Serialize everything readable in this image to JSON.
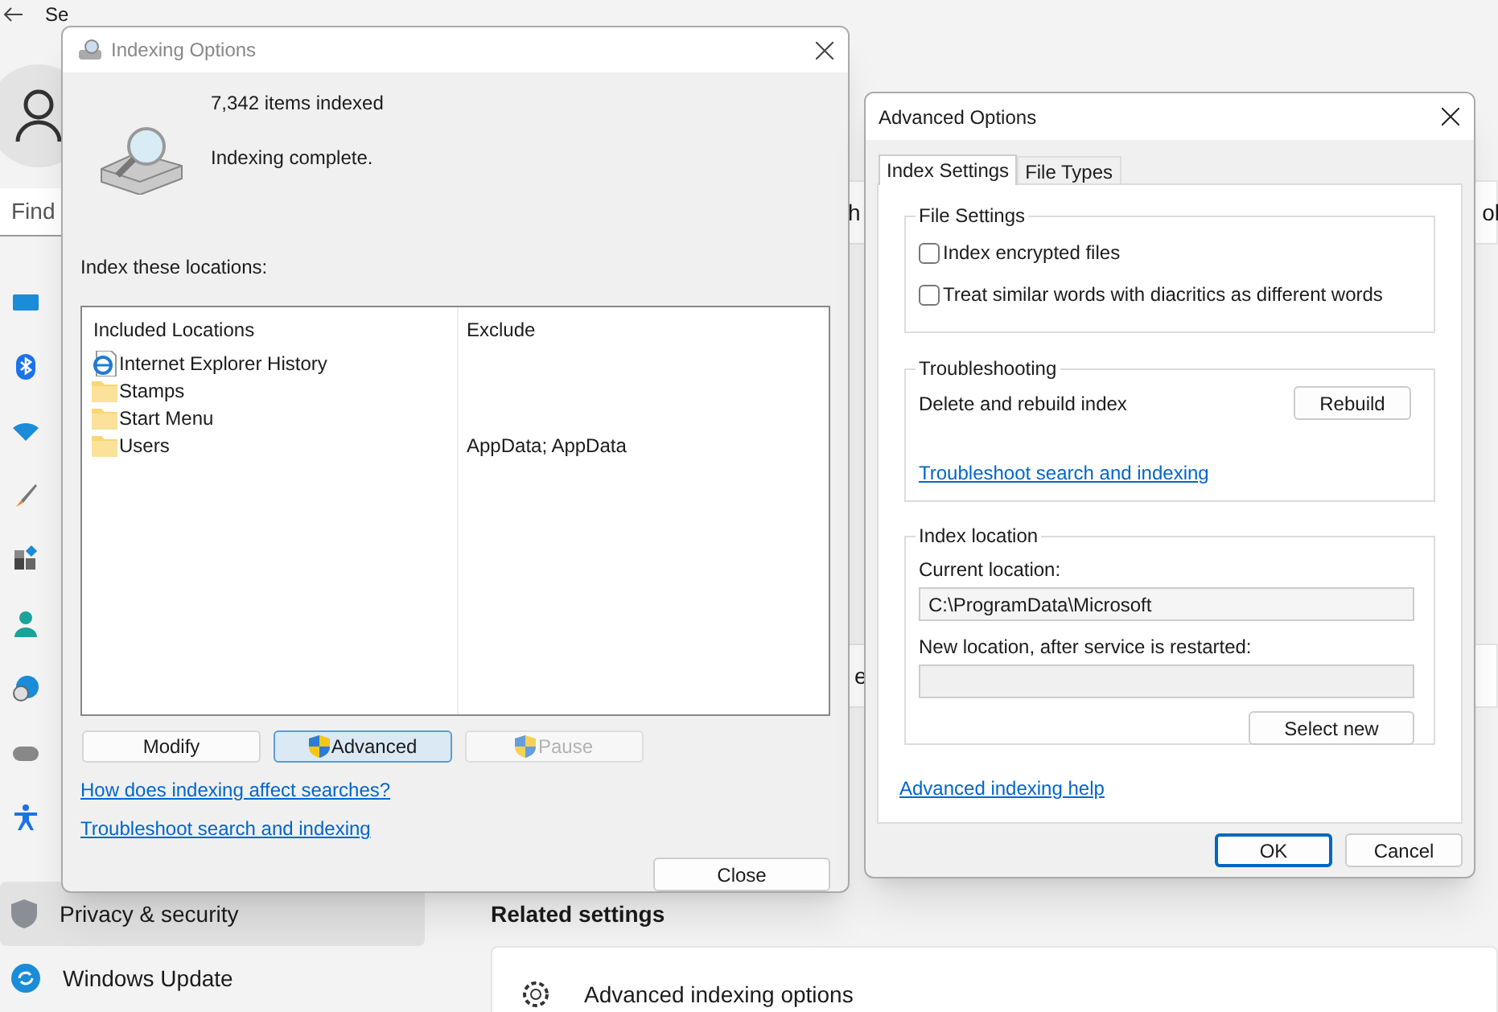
{
  "settings": {
    "title": "Se",
    "search": {
      "placeholder": "Find"
    },
    "nav": [
      {
        "label": "Privacy & security",
        "selected": true
      },
      {
        "label": "Windows Update",
        "selected": false
      }
    ],
    "fragments": [
      "h",
      "ol",
      "e"
    ],
    "related_settings": {
      "heading": "Related settings",
      "items": [
        "Advanced indexing options"
      ]
    }
  },
  "indexing_options": {
    "title": "Indexing Options",
    "count": "7,342 items indexed",
    "status": "Indexing complete.",
    "locations_label": "Index these locations:",
    "columns": [
      "Included Locations",
      "Exclude"
    ],
    "rows": [
      {
        "kind": "web",
        "location": "Internet Explorer History"
      },
      {
        "kind": "folder",
        "location": "Stamps"
      },
      {
        "kind": "folder",
        "location": "Start Menu"
      },
      {
        "kind": "folder",
        "location": "Users",
        "exclude": "AppData; AppData"
      }
    ],
    "buttons": [
      {
        "label": "Modify",
        "shield": false,
        "focused": false,
        "disabled": false
      },
      {
        "label": "Advanced",
        "shield": true,
        "focused": true,
        "disabled": false
      },
      {
        "label": "Pause",
        "shield": true,
        "focused": false,
        "disabled": true
      }
    ],
    "links": [
      "How does indexing affect searches?",
      "Troubleshoot search and indexing"
    ],
    "close_button": "Close"
  },
  "advanced_options": {
    "title": "Advanced Options",
    "tabs": [
      {
        "label": "Index Settings",
        "selected": true
      },
      {
        "label": "File Types",
        "selected": false
      }
    ],
    "file_settings": {
      "heading": "File Settings",
      "options": [
        {
          "label": "Index encrypted files",
          "checked": false
        },
        {
          "label": "Treat similar words with diacritics as different words",
          "checked": false
        }
      ]
    },
    "troubleshooting": {
      "heading": "Troubleshooting",
      "label": "Delete and rebuild index",
      "button": "Rebuild",
      "link": "Troubleshoot search and indexing"
    },
    "index_location": {
      "heading": "Index location",
      "current_label": "Current location:",
      "current_value": "C:\\ProgramData\\Microsoft",
      "new_label": "New location, after service is restarted:",
      "button": "Select new"
    },
    "help_link": "Advanced indexing help",
    "buttons": [
      {
        "label": "OK",
        "default": true
      },
      {
        "label": "Cancel",
        "default": false
      }
    ]
  }
}
